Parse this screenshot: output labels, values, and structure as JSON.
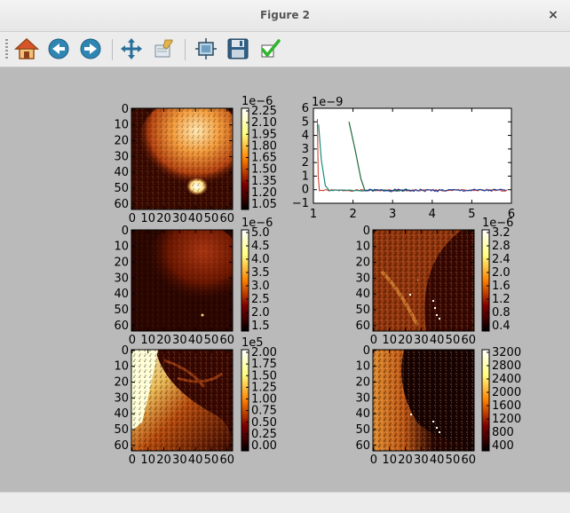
{
  "window": {
    "title": "Figure 2",
    "close_glyph": "×"
  },
  "toolbar": {
    "buttons": [
      {
        "name": "home-button",
        "icon": "home-icon"
      },
      {
        "name": "back-button",
        "icon": "arrow-left-icon"
      },
      {
        "name": "forward-button",
        "icon": "arrow-right-icon"
      },
      {
        "name": "pan-button",
        "icon": "move-arrows-icon"
      },
      {
        "name": "zoom-button",
        "icon": "zoom-rect-icon"
      },
      {
        "name": "subplots-button",
        "icon": "subplots-icon"
      },
      {
        "name": "save-button",
        "icon": "floppy-disk-icon"
      },
      {
        "name": "edit-button",
        "icon": "checkmark-icon"
      }
    ]
  },
  "chart_data": [
    {
      "type": "heatmap",
      "name": "image-1",
      "xticks": [
        "0",
        "10",
        "20",
        "30",
        "40",
        "50",
        "60"
      ],
      "yticks": [
        "0",
        "10",
        "20",
        "30",
        "40",
        "50",
        "60"
      ],
      "colorbar": {
        "exponent": "1e−6",
        "ticks": [
          "2.25",
          "2.10",
          "1.95",
          "1.80",
          "1.65",
          "1.50",
          "1.35",
          "1.20",
          "1.05"
        ]
      }
    },
    {
      "type": "line",
      "name": "line-plot",
      "exponent": "1e−9",
      "xticks": [
        "1",
        "2",
        "3",
        "4",
        "5",
        "6"
      ],
      "yticks": [
        "6",
        "5",
        "4",
        "3",
        "2",
        "1",
        "0",
        "−1"
      ],
      "xlim": [
        1,
        6
      ],
      "ylim": [
        -1,
        6
      ]
    },
    {
      "type": "heatmap",
      "name": "image-2",
      "xticks": [
        "0",
        "10",
        "20",
        "30",
        "40",
        "50",
        "60"
      ],
      "yticks": [
        "0",
        "10",
        "20",
        "30",
        "40",
        "50",
        "60"
      ],
      "colorbar": {
        "exponent": "1e−6",
        "ticks": [
          "5.0",
          "4.5",
          "4.0",
          "3.5",
          "3.0",
          "2.5",
          "2.0",
          "1.5"
        ]
      }
    },
    {
      "type": "heatmap",
      "name": "image-3",
      "xticks": [
        "0",
        "10",
        "20",
        "30",
        "40",
        "50",
        "60"
      ],
      "yticks": [
        "0",
        "10",
        "20",
        "30",
        "40",
        "50",
        "60"
      ],
      "colorbar": {
        "exponent": "1e−6",
        "ticks": [
          "3.2",
          "2.8",
          "2.4",
          "2.0",
          "1.6",
          "1.2",
          "0.8",
          "0.4"
        ]
      }
    },
    {
      "type": "heatmap",
      "name": "image-4",
      "xticks": [
        "0",
        "10",
        "20",
        "30",
        "40",
        "50",
        "60"
      ],
      "yticks": [
        "0",
        "10",
        "20",
        "30",
        "40",
        "50",
        "60"
      ],
      "colorbar": {
        "exponent": "1e5",
        "ticks": [
          "2.00",
          "1.75",
          "1.50",
          "1.25",
          "1.00",
          "0.75",
          "0.50",
          "0.25",
          "0.00"
        ]
      }
    },
    {
      "type": "heatmap",
      "name": "image-5",
      "xticks": [
        "0",
        "10",
        "20",
        "30",
        "40",
        "50",
        "60"
      ],
      "yticks": [
        "0",
        "10",
        "20",
        "30",
        "40",
        "50",
        "60"
      ],
      "colorbar": {
        "exponent": "",
        "ticks": [
          "3200",
          "2800",
          "2400",
          "2000",
          "1600",
          "1200",
          "800",
          "400"
        ]
      }
    }
  ]
}
